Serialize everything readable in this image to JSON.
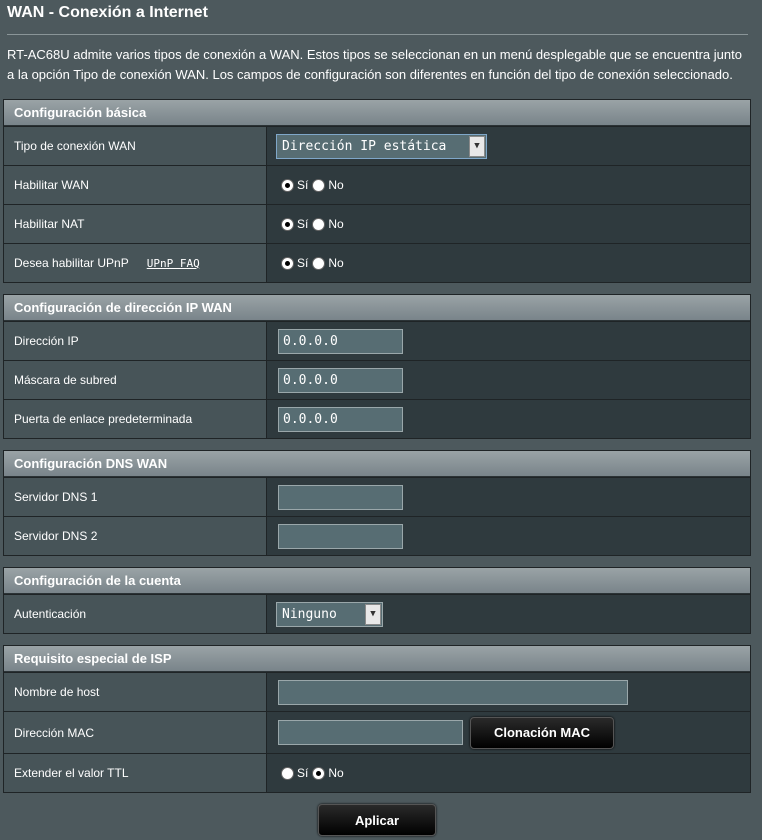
{
  "page": {
    "title": "WAN - Conexión a Internet",
    "description": "RT-AC68U admite varios tipos de conexión a WAN. Estos tipos se seleccionan en un menú desplegable que se encuentra junto a la opción Tipo de conexión WAN. Los campos de configuración son diferentes en función del tipo de conexión seleccionado."
  },
  "basic": {
    "header": "Configuración básica",
    "wan_type_label": "Tipo de conexión WAN",
    "wan_type_value": "Dirección IP estática",
    "enable_wan_label": "Habilitar WAN",
    "enable_nat_label": "Habilitar NAT",
    "upnp_label": "Desea habilitar UPnP",
    "upnp_faq": "UPnP FAQ",
    "yes": "Sí",
    "no": "No"
  },
  "wan_ip": {
    "header": "Configuración de dirección IP WAN",
    "ip_label": "Dirección IP",
    "ip_value": "0.0.0.0",
    "mask_label": "Máscara de subred",
    "mask_value": "0.0.0.0",
    "gateway_label": "Puerta de enlace predeterminada",
    "gateway_value": "0.0.0.0"
  },
  "dns": {
    "header": "Configuración DNS WAN",
    "dns1_label": "Servidor DNS 1",
    "dns1_value": "",
    "dns2_label": "Servidor DNS 2",
    "dns2_value": ""
  },
  "account": {
    "header": "Configuración de la cuenta",
    "auth_label": "Autenticación",
    "auth_value": "Ninguno"
  },
  "isp": {
    "header": "Requisito especial de ISP",
    "hostname_label": "Nombre de host",
    "hostname_value": "",
    "mac_label": "Dirección MAC",
    "mac_value": "",
    "mac_clone_button": "Clonación MAC",
    "ttl_label": "Extender el valor TTL",
    "yes": "Sí",
    "no": "No"
  },
  "apply_button": "Aplicar"
}
